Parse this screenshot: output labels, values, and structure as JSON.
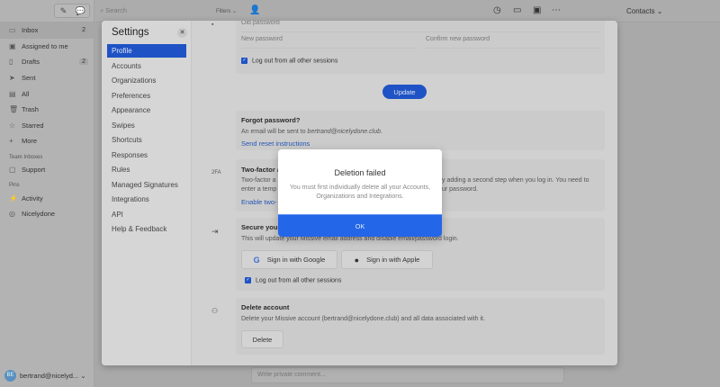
{
  "sidebar": {
    "items": [
      {
        "label": "Inbox",
        "count": "2",
        "icon": "inbox-icon"
      },
      {
        "label": "Assigned to me",
        "icon": "assigned-icon"
      },
      {
        "label": "Drafts",
        "count": "2",
        "icon": "draft-icon"
      },
      {
        "label": "Sent",
        "icon": "send-icon"
      },
      {
        "label": "All",
        "icon": "archive-icon"
      },
      {
        "label": "Trash",
        "icon": "trash-icon"
      },
      {
        "label": "Starred",
        "icon": "star-icon"
      },
      {
        "label": "More",
        "icon": "plus-icon"
      }
    ],
    "team_label": "Team Inboxes",
    "team": [
      {
        "label": "Support"
      }
    ],
    "pins_label": "Pins",
    "pins": [
      {
        "label": "Activity"
      },
      {
        "label": "Nicelydone"
      }
    ],
    "user": {
      "initials": "BE",
      "name": "bertrand@nicelyd..."
    }
  },
  "topbar": {
    "search_placeholder": "Search",
    "filters": "Filters",
    "contacts": "Contacts"
  },
  "comment_placeholder": "Write private comment...",
  "settings": {
    "title": "Settings",
    "nav": [
      "Profile",
      "Accounts",
      "Organizations",
      "Preferences",
      "Appearance",
      "Swipes",
      "Shortcuts",
      "Responses",
      "Rules",
      "Managed Signatures",
      "Integrations",
      "API",
      "Help & Feedback"
    ],
    "password": {
      "old": "Old password",
      "new": "New password",
      "confirm": "Confirm new password",
      "logout": "Log out from all other sessions",
      "update": "Update"
    },
    "forgot": {
      "title": "Forgot password?",
      "text_prefix": "An email will be sent to ",
      "email": "bertrand@nicelydone.club",
      "text_suffix": ".",
      "link": "Send reset instructions"
    },
    "twofa": {
      "icon_label": "2FA",
      "title": "Two-factor a",
      "text1a": "Two-factor a",
      "text1b": "y adding a second step when you log in. You need to",
      "text2a": "enter a temp",
      "text2b": "ur password.",
      "link": "Enable two-"
    },
    "secure": {
      "title": "Secure your",
      "text": "This will update your Missive email address and disable email/password login.",
      "google": "Sign in with Google",
      "apple": "Sign in with Apple",
      "logout": "Log out from all other sessions"
    },
    "delete": {
      "title": "Delete account",
      "text": "Delete your Missive account (bertrand@nicelydone.club) and all data associated with it.",
      "button": "Delete"
    }
  },
  "dialog": {
    "title": "Deletion failed",
    "message": "You must first individually delete all your Accounts, Organizations and Integrations.",
    "ok": "OK"
  }
}
